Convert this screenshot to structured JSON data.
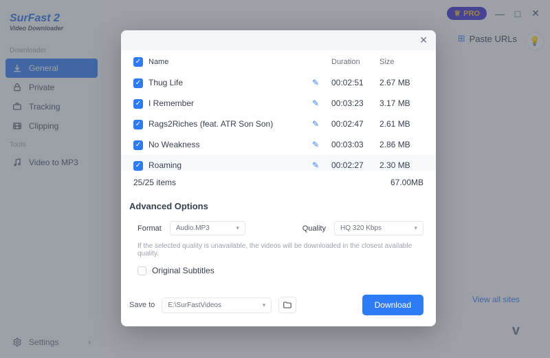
{
  "brand": {
    "name": "SurFast 2",
    "sub": "Video Downloader"
  },
  "sections": {
    "downloader_label": "Downloader",
    "tools_label": "Tools"
  },
  "sidebar": {
    "items": [
      {
        "label": "General",
        "icon": "download"
      },
      {
        "label": "Private",
        "icon": "lock"
      },
      {
        "label": "Tracking",
        "icon": "radar"
      },
      {
        "label": "Clipping",
        "icon": "film"
      }
    ],
    "tools": [
      {
        "label": "Video to MP3",
        "icon": "music"
      }
    ],
    "settings_label": "Settings"
  },
  "topbar": {
    "pro_label": "PRO",
    "paste_label": "Paste URLs",
    "view_all": "View all sites"
  },
  "modal": {
    "columns": {
      "name": "Name",
      "duration": "Duration",
      "size": "Size"
    },
    "rows": [
      {
        "name": "Thug Life",
        "duration": "00:02:51",
        "size": "2.67 MB"
      },
      {
        "name": "I Remember",
        "duration": "00:03:23",
        "size": "3.17 MB"
      },
      {
        "name": "Rags2Riches (feat. ATR Son Son)",
        "duration": "00:02:47",
        "size": "2.61 MB"
      },
      {
        "name": "No Weakness",
        "duration": "00:03:03",
        "size": "2.86 MB"
      },
      {
        "name": "Roaming",
        "duration": "00:02:27",
        "size": "2.30 MB"
      }
    ],
    "items_count": "25/25 items",
    "total_size": "67.00MB",
    "advanced_label": "Advanced Options",
    "format_label": "Format",
    "format_value": "Audio.MP3",
    "quality_label": "Quality",
    "quality_value": "HQ 320 Kbps",
    "quality_note": "If the selected quality is unavailable, the videos will be downloaded in the closest available quality.",
    "subtitles_label": "Original Subtitles",
    "save_to_label": "Save to",
    "save_to_path": "E:\\SurFastVideos",
    "download_label": "Download"
  }
}
